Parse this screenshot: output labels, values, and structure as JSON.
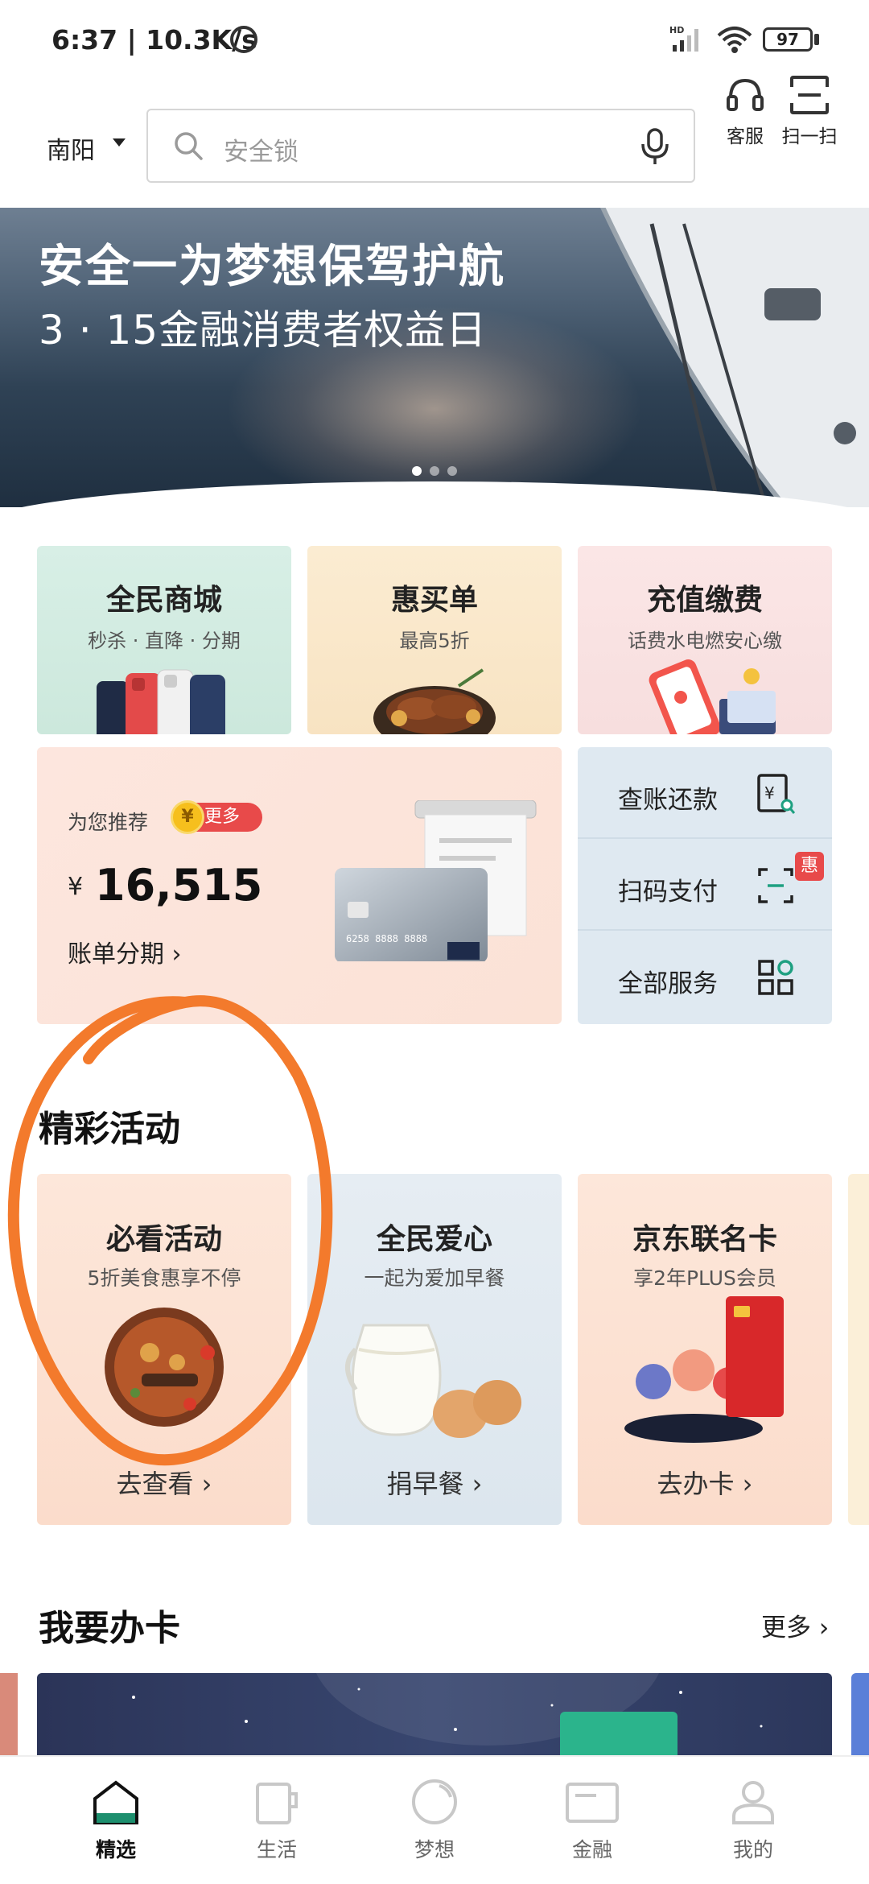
{
  "status_bar": {
    "time": "6:37 | 10.3K/s",
    "battery": "97",
    "network": "HD"
  },
  "header": {
    "city": "南阳",
    "search_placeholder": "安全锁",
    "service_label": "客服",
    "scan_label": "扫一扫"
  },
  "banner": {
    "title": "安全一为梦想保驾护航",
    "subtitle": "3 · 15金融消费者权益日",
    "pages": 3,
    "active_page": 1
  },
  "quick_cards": [
    {
      "title": "全民商城",
      "subtitle": "秒杀 · 直降 · 分期"
    },
    {
      "title": "惠买单",
      "subtitle": "最高5折"
    },
    {
      "title": "充值缴费",
      "subtitle": "话费水电燃安心缴"
    }
  ],
  "recommend": {
    "label": "为您推荐",
    "more": "更多",
    "currency": "¥",
    "amount": "16,515",
    "link": "账单分期 ›",
    "coin_symbol": "¥",
    "card_number": "6258 8888 8888"
  },
  "services": [
    {
      "label": "查账还款"
    },
    {
      "label": "扫码支付",
      "badge": "惠"
    },
    {
      "label": "全部服务"
    }
  ],
  "activities": {
    "title": "精彩活动",
    "cards": [
      {
        "title": "必看活动",
        "subtitle": "5折美食惠享不停",
        "cta": "去查看 ›"
      },
      {
        "title": "全民爱心",
        "subtitle": "一起为爱加早餐",
        "cta": "捐早餐 ›"
      },
      {
        "title": "京东联名卡",
        "subtitle": "享2年PLUS会员",
        "cta": "去办卡 ›"
      }
    ]
  },
  "apply_card": {
    "title": "我要办卡",
    "more": "更多 ›"
  },
  "bottom_nav": [
    {
      "label": "精选",
      "active": true
    },
    {
      "label": "生活",
      "active": false
    },
    {
      "label": "梦想",
      "active": false
    },
    {
      "label": "金融",
      "active": false
    },
    {
      "label": "我的",
      "active": false
    }
  ],
  "colors": {
    "accent_red": "#e84a4a",
    "annotation_orange": "#f37a2c",
    "nav_active": "#1d8f6e"
  }
}
